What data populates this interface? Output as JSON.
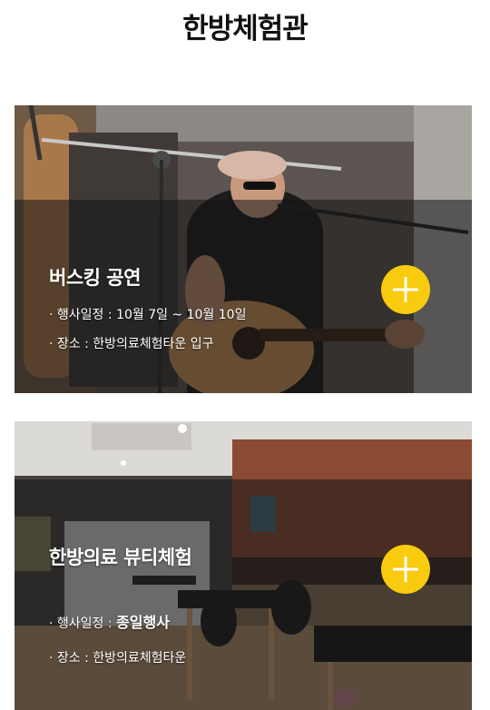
{
  "header": {
    "title": "한방체험관"
  },
  "cards": [
    {
      "title": "버스킹 공연",
      "schedule_prefix": "· 행사일정 : ",
      "schedule_value": "10월 7일 ~ 10월 10일",
      "location": "· 장소 : 한방의료체험타운 입구",
      "button_icon": "plus-icon",
      "button_color": "#f8cb0e"
    },
    {
      "title": "한방의료 뷰티체험",
      "schedule_prefix": "· 행사일정 : ",
      "schedule_value": "종일행사",
      "location": "· 장소 : 한방의료체험타운",
      "button_icon": "plus-icon",
      "button_color": "#f8cb0e"
    }
  ]
}
